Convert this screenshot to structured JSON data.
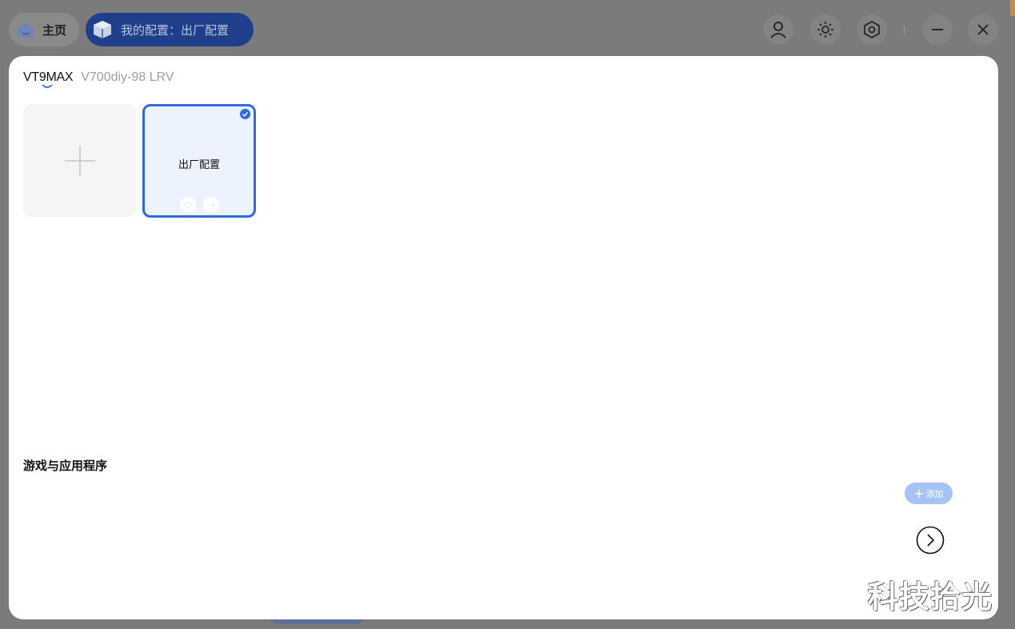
{
  "topbar": {
    "home_label": "主页",
    "config_label": "我的配置：出厂配置",
    "icons": [
      "user-icon",
      "brightness-icon",
      "settings-hex-icon",
      "minimize-icon",
      "close-icon"
    ]
  },
  "modal": {
    "brand": "VT9MAX",
    "model": "V700diy-98 LRV",
    "profiles": [
      {
        "name": "出厂配置",
        "selected": true
      }
    ],
    "section_title": "游戏与应用程序",
    "add_label": "添加"
  },
  "watermark": "科技拾光",
  "colors": {
    "accent": "#2f6ae0",
    "pill_active": "#1f3f8a",
    "add_button": "#a6c3f5"
  }
}
